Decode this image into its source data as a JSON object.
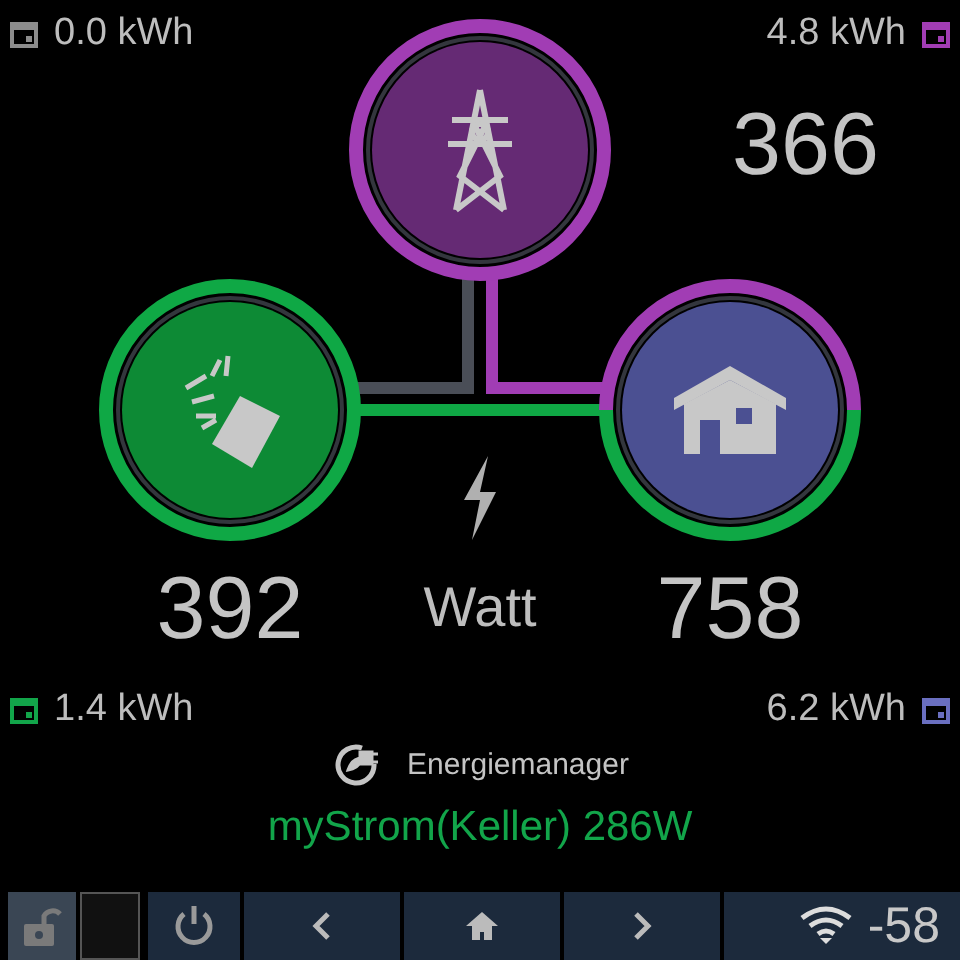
{
  "totals": [
    {
      "value": "0.0 kWh",
      "color": "#8c8c8c"
    },
    {
      "value": "4.8 kWh",
      "color": "#a13db4"
    },
    {
      "value": "1.4 kWh",
      "color": "#12a54a"
    },
    {
      "value": "6.2 kWh",
      "color": "#6a6fc0"
    }
  ],
  "nodes": [
    {
      "kind": "grid",
      "value": "366",
      "color": "#652a74",
      "ring": [
        {
          "color": "#a13db4"
        }
      ]
    },
    {
      "kind": "solar",
      "value": "392",
      "color": "#0d8a35",
      "ring": [
        {
          "color": "#0fa845"
        }
      ]
    },
    {
      "kind": "house",
      "value": "758",
      "color": "#4b5092",
      "ring": [
        {
          "color": "#a13db4"
        },
        {
          "color": "#0fa845"
        }
      ]
    }
  ],
  "links": [
    {
      "color": "#4a4e57"
    },
    {
      "color": "#a13db4"
    },
    {
      "color": "#0fa845"
    }
  ],
  "unit": "Watt",
  "device": {
    "title": "Energiemanager",
    "status": "myStrom(Keller) 286W"
  },
  "footer": {
    "locked": false,
    "signal": "-58"
  }
}
